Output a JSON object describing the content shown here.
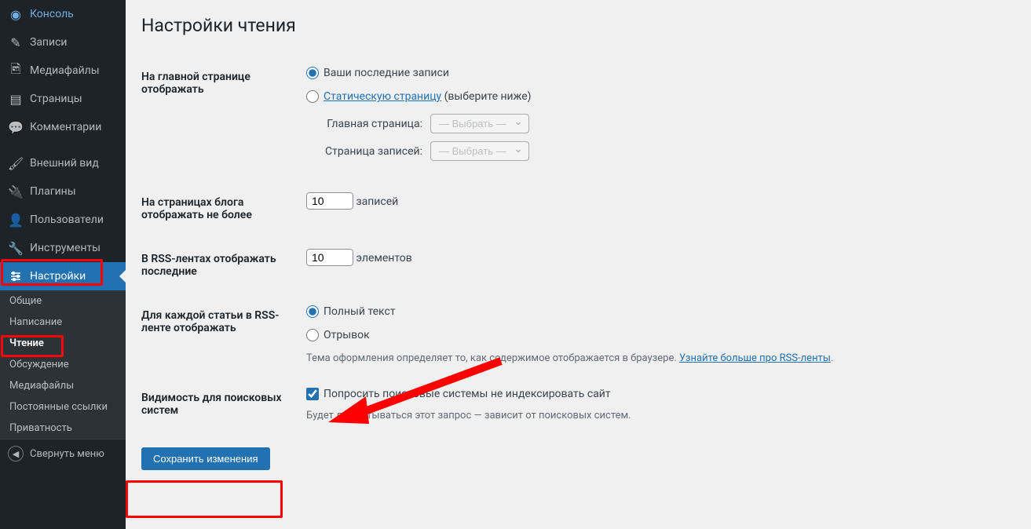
{
  "sidebar": {
    "items": [
      {
        "label": "Консоль",
        "icon": "dashboard"
      },
      {
        "label": "Записи",
        "icon": "pin"
      },
      {
        "label": "Медиафайлы",
        "icon": "media"
      },
      {
        "label": "Страницы",
        "icon": "page"
      },
      {
        "label": "Комментарии",
        "icon": "comment"
      },
      {
        "label": "Внешний вид",
        "icon": "brush"
      },
      {
        "label": "Плагины",
        "icon": "plug"
      },
      {
        "label": "Пользователи",
        "icon": "users"
      },
      {
        "label": "Инструменты",
        "icon": "wrench"
      },
      {
        "label": "Настройки",
        "icon": "sliders",
        "active": true
      }
    ],
    "submenu": [
      {
        "label": "Общие"
      },
      {
        "label": "Написание"
      },
      {
        "label": "Чтение",
        "current": true
      },
      {
        "label": "Обсуждение"
      },
      {
        "label": "Медиафайлы"
      },
      {
        "label": "Постоянные ссылки"
      },
      {
        "label": "Приватность"
      }
    ],
    "collapse": "Свернуть меню"
  },
  "page": {
    "title": "Настройки чтения",
    "front": {
      "label": "На главной странице отображать",
      "opt_latest": "Ваши последние записи",
      "opt_static": "Статическую страницу",
      "opt_static_hint": "(выберите ниже)",
      "homepage_label": "Главная страница:",
      "posts_page_label": "Страница записей:",
      "select_placeholder": "— Выбрать —"
    },
    "blog": {
      "label": "На страницах блога отображать не более",
      "value": "10",
      "unit": "записей"
    },
    "rss": {
      "label": "В RSS-лентах отображать последние",
      "value": "10",
      "unit": "элементов"
    },
    "rss_each": {
      "label": "Для каждой статьи в RSS-ленте отображать",
      "opt_full": "Полный текст",
      "opt_excerpt": "Отрывок",
      "desc_pre": "Тема оформления определяет то, как содержимое отображается в браузере. ",
      "desc_link": "Узнайте больше про RSS-ленты",
      "desc_post": "."
    },
    "seo": {
      "label": "Видимость для поисковых систем",
      "checkbox": "Попросить поисковые системы не индексировать сайт",
      "desc": "Будет ли учитываться этот запрос — зависит от поисковых систем."
    },
    "save": "Сохранить изменения"
  }
}
